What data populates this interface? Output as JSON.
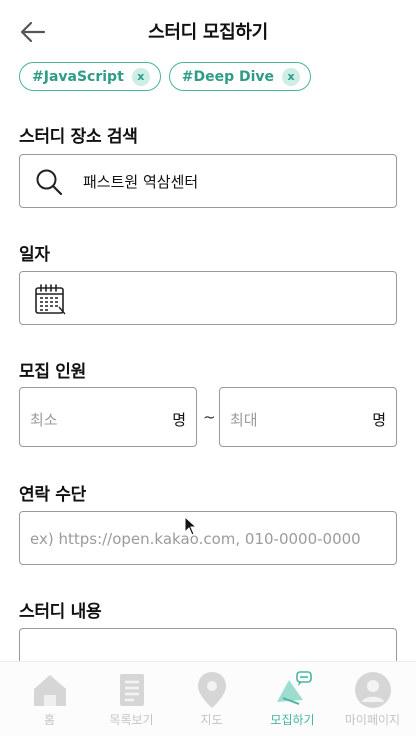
{
  "header": {
    "title": "스터디 모집하기",
    "back_icon": "arrow-left-icon"
  },
  "tags": [
    {
      "label": "#JavaScript",
      "remove": "x"
    },
    {
      "label": "#Deep Dive",
      "remove": "x"
    }
  ],
  "location": {
    "label": "스터디 장소 검색",
    "value": "패스트원 역삼센터",
    "icon": "search-icon"
  },
  "date": {
    "label": "일자",
    "icon": "calendar-icon"
  },
  "members": {
    "label": "모집 인원",
    "min_placeholder": "최소",
    "max_placeholder": "최대",
    "unit": "명",
    "separator": "~"
  },
  "contact": {
    "label": "연락 수단",
    "placeholder": "ex) https://open.kakao.com, 010-0000-0000"
  },
  "description": {
    "label": "스터디 내용"
  },
  "tabbar": {
    "items": [
      {
        "label": "홈",
        "icon": "home-icon"
      },
      {
        "label": "목록보기",
        "icon": "list-icon"
      },
      {
        "label": "지도",
        "icon": "map-pin-icon"
      },
      {
        "label": "모집하기",
        "icon": "megaphone-icon"
      },
      {
        "label": "마이페이지",
        "icon": "user-icon"
      }
    ],
    "active_index": 3
  },
  "colors": {
    "accent": "#48b5a1",
    "accent_light": "#cdeee6",
    "inactive": "#c4c4c4",
    "border": "#9a9a9a"
  }
}
